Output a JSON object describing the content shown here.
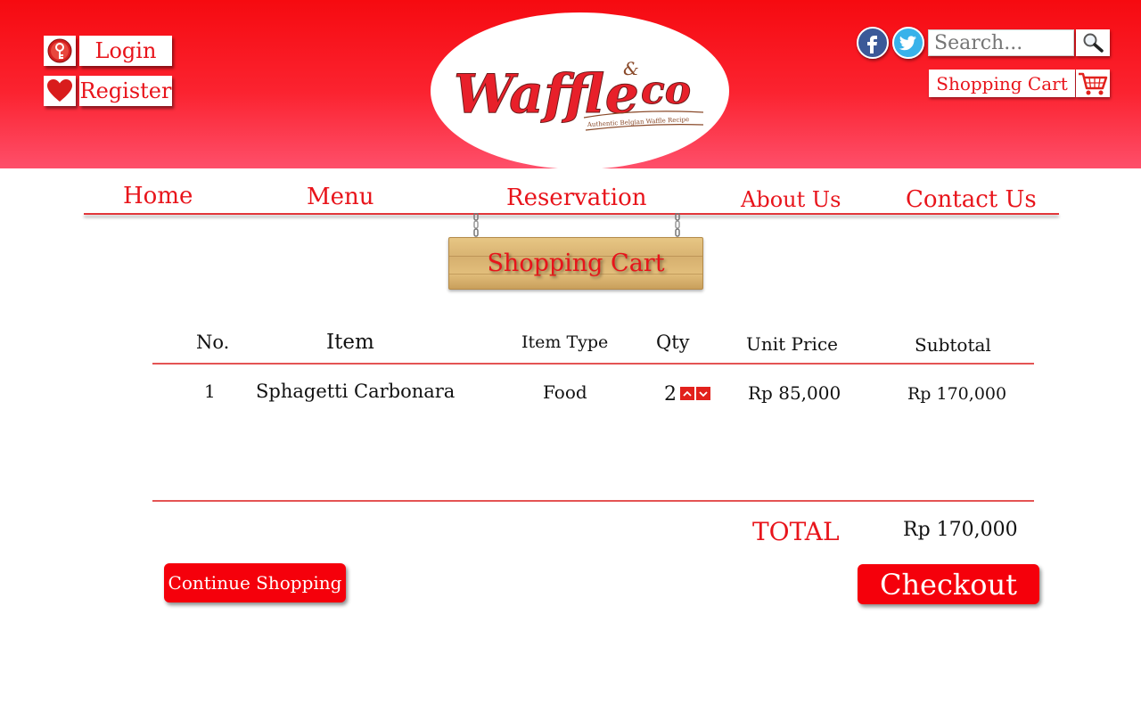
{
  "header": {
    "login_label": "Login",
    "register_label": "Register",
    "login_icon": "key-icon",
    "register_icon": "heart-icon",
    "brand_colors": {
      "primary": "#f60a10",
      "accent": "#fe4f6a",
      "text_red": "#e8141b"
    }
  },
  "logo": {
    "name": "Waffle",
    "ampersand": "&",
    "co": "co",
    "tagline": "Authentic Belgian Waffle Recipe"
  },
  "social": {
    "facebook_icon": "facebook-icon",
    "twitter_icon": "twitter-icon"
  },
  "search": {
    "placeholder": "Search...",
    "icon": "search-icon"
  },
  "cart_link": {
    "label": "Shopping Cart",
    "icon": "cart-icon"
  },
  "nav": {
    "items": [
      {
        "label": "Home"
      },
      {
        "label": "Menu"
      },
      {
        "label": "Reservation"
      },
      {
        "label": "About Us"
      },
      {
        "label": "Contact Us"
      }
    ]
  },
  "page": {
    "sign_title": "Shopping Cart"
  },
  "cart": {
    "headers": {
      "no": "No.",
      "item": "Item",
      "type": "Item Type",
      "qty": "Qty",
      "unit_price": "Unit Price",
      "subtotal": "Subtotal"
    },
    "rows": [
      {
        "no": "1",
        "item": "Sphagetti Carbonara",
        "type": "Food",
        "qty": "2",
        "unit_price": "Rp 85,000",
        "subtotal": "Rp 170,000"
      }
    ],
    "total_label": "TOTAL",
    "total_value": "Rp 170,000"
  },
  "actions": {
    "continue_label": "Continue Shopping",
    "checkout_label": "Checkout"
  }
}
